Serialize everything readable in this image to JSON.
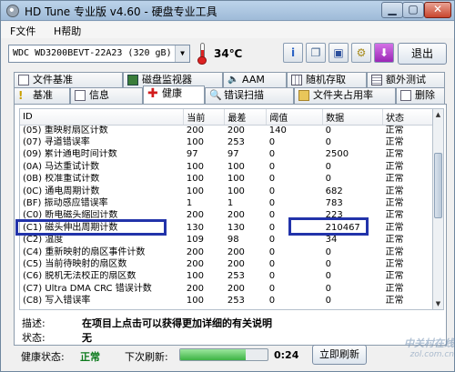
{
  "window": {
    "title": "HD Tune 专业版 v4.60 - 硬盘专业工具"
  },
  "menu": {
    "file": "F文件",
    "help": "H帮助"
  },
  "toolbar": {
    "drive": "WDC WD3200BEVT-22A23    (320 gB)",
    "temperature": "34℃",
    "exit": "退出",
    "icons": [
      "info-icon",
      "copy-icon",
      "save-icon",
      "options-icon",
      "download-icon"
    ]
  },
  "tabs": {
    "row1": [
      "文件基准",
      "磁盘监视器",
      "AAM",
      "随机存取",
      "额外测试"
    ],
    "row2": [
      "基准",
      "信息",
      "健康",
      "错误扫描",
      "文件夹占用率",
      "删除"
    ],
    "active": "健康"
  },
  "table": {
    "headers": [
      "ID",
      "当前",
      "最差",
      "阈值",
      "数据",
      "状态"
    ],
    "rows": [
      [
        "(05) 重映射扇区计数",
        "200",
        "200",
        "140",
        "0",
        "正常"
      ],
      [
        "(07) 寻道错误率",
        "100",
        "253",
        "0",
        "0",
        "正常"
      ],
      [
        "(09) 累计通电时间计数",
        "97",
        "97",
        "0",
        "2500",
        "正常"
      ],
      [
        "(0A) 马达重试计数",
        "100",
        "100",
        "0",
        "0",
        "正常"
      ],
      [
        "(0B) 校准重试计数",
        "100",
        "100",
        "0",
        "0",
        "正常"
      ],
      [
        "(0C) 通电周期计数",
        "100",
        "100",
        "0",
        "682",
        "正常"
      ],
      [
        "(BF) 振动感应错误率",
        "1",
        "1",
        "0",
        "783",
        "正常"
      ],
      [
        "(C0) 断电磁头缩回计数",
        "200",
        "200",
        "0",
        "223",
        "正常"
      ],
      [
        "(C1) 磁头伸出周期计数",
        "130",
        "130",
        "0",
        "210467",
        "正常"
      ],
      [
        "(C2) 温度",
        "109",
        "98",
        "0",
        "34",
        "正常"
      ],
      [
        "(C4) 重新映射的扇区事件计数",
        "200",
        "200",
        "0",
        "0",
        "正常"
      ],
      [
        "(C5) 当前待映射的扇区数",
        "200",
        "200",
        "0",
        "0",
        "正常"
      ],
      [
        "(C6) 脱机无法校正的扇区数",
        "100",
        "253",
        "0",
        "0",
        "正常"
      ],
      [
        "(C7) Ultra DMA CRC 错误计数",
        "200",
        "200",
        "0",
        "0",
        "正常"
      ],
      [
        "(C8) 写入错误率",
        "100",
        "253",
        "0",
        "0",
        "正常"
      ]
    ]
  },
  "description": {
    "label": "描述:",
    "text": "在项目上点击可以获得更加详细的有关说明"
  },
  "state": {
    "label": "状态:",
    "text": "无"
  },
  "footer": {
    "health_label": "健康状态:",
    "health_value": "正常",
    "next_refresh_label": "下次刷新:",
    "countdown": "0:24",
    "progress_fraction": 0.75,
    "refresh_button": "立即刷新"
  },
  "watermark": {
    "line1": "中关村在线",
    "line2": "zol.com.cn"
  }
}
